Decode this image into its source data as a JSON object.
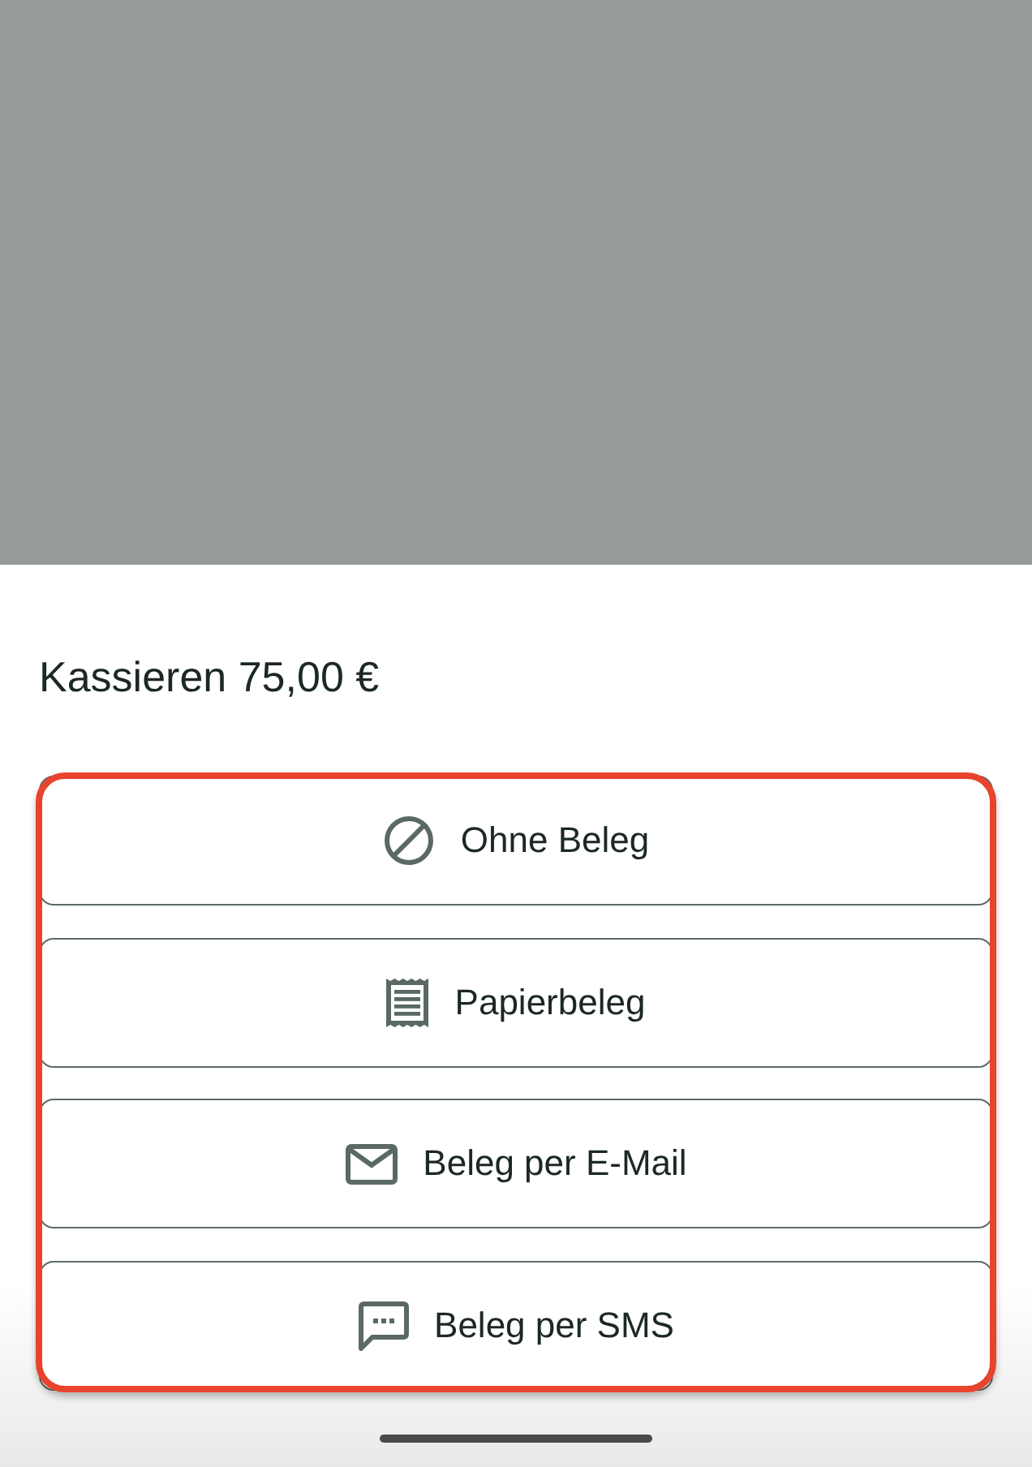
{
  "title": "Kassieren 75,00 €",
  "options_highlighted": true,
  "options": [
    {
      "kind": "none",
      "label": "Ohne Beleg"
    },
    {
      "kind": "paper",
      "label": "Papierbeleg"
    },
    {
      "kind": "email",
      "label": "Beleg per E-Mail"
    },
    {
      "kind": "sms",
      "label": "Beleg per SMS"
    }
  ]
}
